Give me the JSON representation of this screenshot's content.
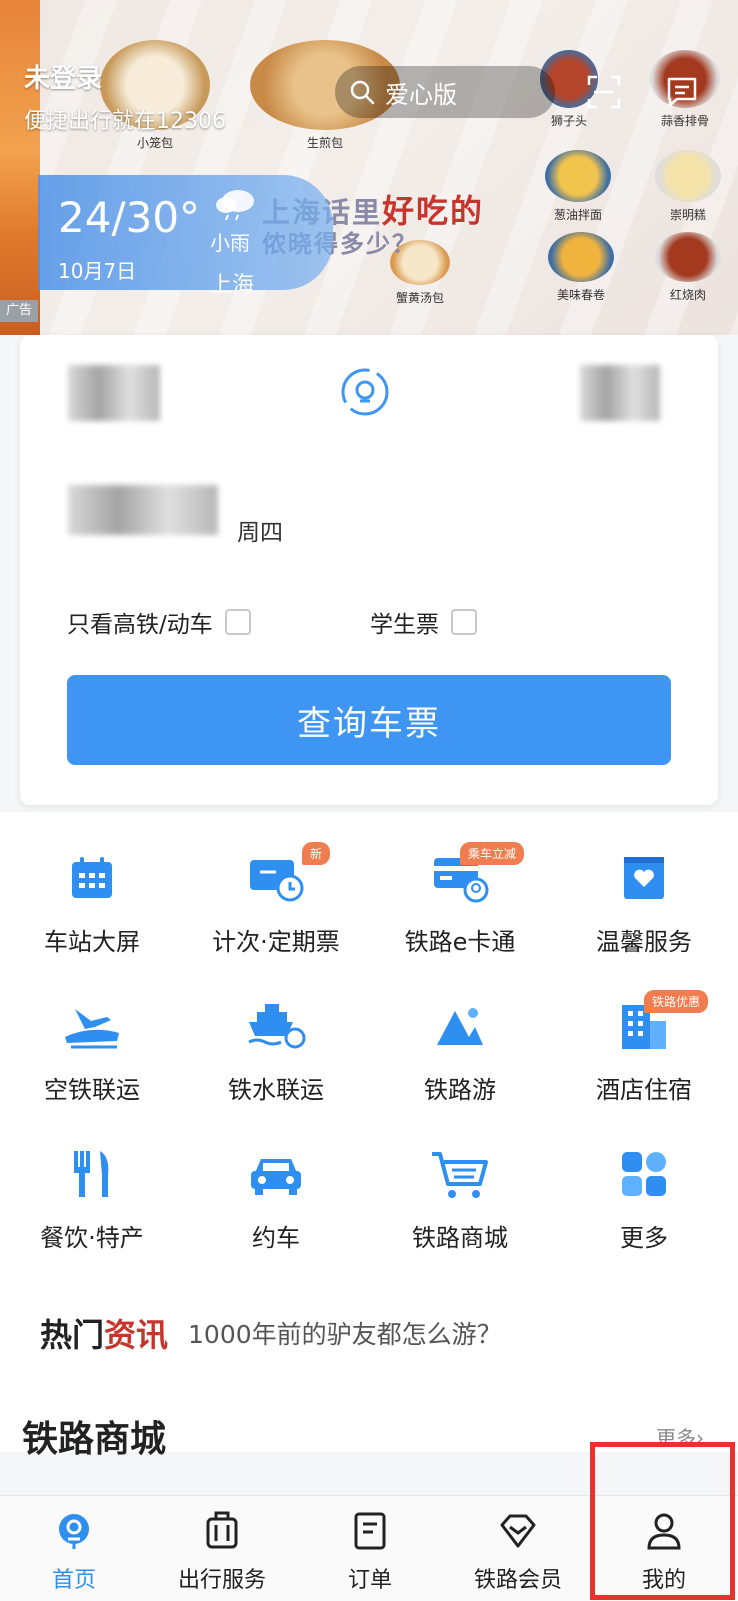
{
  "banner": {
    "user_title": "未登录",
    "user_sub": "便捷出行就在12306",
    "search_label": "爱心版",
    "ad_tag": "广告",
    "weather": {
      "temp": "24/30°",
      "condition": "小雨",
      "date": "10月7日",
      "city": "上海"
    },
    "promo_line1_a": "上海话里",
    "promo_line1_hl": "好吃的",
    "promo_line2": "侬晓得多少？",
    "foods": [
      "小笼包",
      "生煎包",
      "狮子头",
      "蒜香排骨",
      "葱油拌面",
      "崇明糕",
      "蟹黄汤包",
      "美味春卷",
      "红烧肉"
    ]
  },
  "ticket": {
    "weekday": "周四",
    "only_highspeed": "只看高铁/动车",
    "student": "学生票",
    "query_button": "查询车票"
  },
  "services": [
    {
      "label": "车站大屏",
      "icon": "calendar-icon",
      "badge": ""
    },
    {
      "label": "计次·定期票",
      "icon": "ticket-clock-icon",
      "badge": "新"
    },
    {
      "label": "铁路e卡通",
      "icon": "card-icon",
      "badge": "乘车立减"
    },
    {
      "label": "温馨服务",
      "icon": "heart-bag-icon",
      "badge": ""
    },
    {
      "label": "空铁联运",
      "icon": "plane-train-icon",
      "badge": ""
    },
    {
      "label": "铁水联运",
      "icon": "ship-icon",
      "badge": ""
    },
    {
      "label": "铁路游",
      "icon": "mountain-icon",
      "badge": ""
    },
    {
      "label": "酒店住宿",
      "icon": "hotel-icon",
      "badge": "铁路优惠"
    },
    {
      "label": "餐饮·特产",
      "icon": "fork-knife-icon",
      "badge": ""
    },
    {
      "label": "约车",
      "icon": "car-icon",
      "badge": ""
    },
    {
      "label": "铁路商城",
      "icon": "cart-icon",
      "badge": ""
    },
    {
      "label": "更多",
      "icon": "grid-icon",
      "badge": ""
    }
  ],
  "news": {
    "tag_a": "热门",
    "tag_b": "资讯",
    "text": "1000年前的驴友都怎么游？"
  },
  "mall": {
    "title": "铁路商城",
    "more": "更多"
  },
  "nav": [
    {
      "label": "首页",
      "icon": "home-train-icon",
      "active": true
    },
    {
      "label": "出行服务",
      "icon": "luggage-icon",
      "active": false
    },
    {
      "label": "订单",
      "icon": "order-icon",
      "active": false
    },
    {
      "label": "铁路会员",
      "icon": "diamond-icon",
      "active": false
    },
    {
      "label": "我的",
      "icon": "user-icon",
      "active": false
    }
  ],
  "colors": {
    "primary": "#3f96f2",
    "badge": "#f07d4f",
    "highlight": "#e8322b"
  }
}
